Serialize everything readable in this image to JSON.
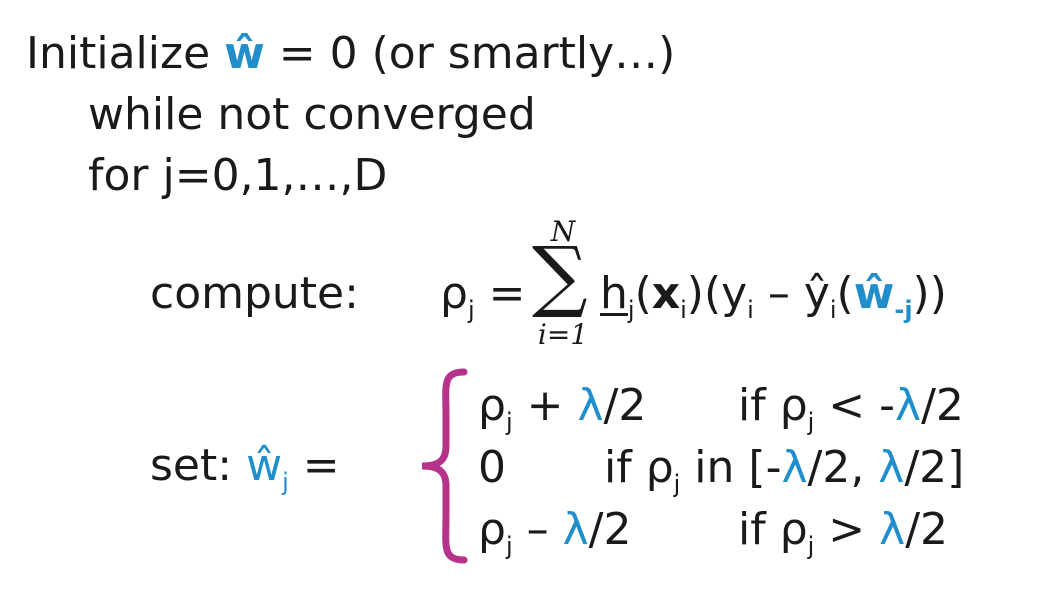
{
  "line1": {
    "pre": "Initialize ",
    "w": "ŵ",
    "post": " = 0 (or smartly…)"
  },
  "line2": {
    "text": "while not converged"
  },
  "line3": {
    "text": "for j=0,1,…,D"
  },
  "compute": {
    "label": "compute:",
    "rho": "ρ",
    "j": "j",
    "eq": " =",
    "sum_top": "N",
    "sum_bottom": "i=1",
    "h": "h",
    "hsub": "j",
    "paren_open": "(",
    "x": "x",
    "xsub": "i",
    "mid": ")(y",
    "ysub": "i",
    "minus": " – ŷ",
    "yhatsub": "i",
    "open2": "(",
    "w": "ŵ",
    "wsub": "-j",
    "close": "))"
  },
  "set": {
    "label": "set:  ",
    "w": "ŵ",
    "wsub": "j",
    "eq": " ="
  },
  "cases": [
    {
      "a1": "ρ",
      "a1sub": "j",
      "a2": " + ",
      "lam": "λ",
      "a3": "/2",
      "cond1": "if ρ",
      "condsub": "j",
      "cond2": " < -",
      "clam": "λ",
      "cond3": "/2"
    },
    {
      "a1": "0",
      "cond1": "if ρ",
      "condsub": "j",
      "cond2": " in [-",
      "clam": "λ",
      "cond3": "/2, ",
      "clam2": "λ",
      "cond4": "/2]"
    },
    {
      "a1": "ρ",
      "a1sub": "j",
      "a2": " – ",
      "lam": "λ",
      "a3": "/2",
      "cond1": "if ρ",
      "condsub": "j",
      "cond2": " > ",
      "clam": "λ",
      "cond3": "/2"
    }
  ],
  "colors": {
    "accent": "#1f8ecb",
    "brace": "#b5338a",
    "text": "#1a1a1a"
  }
}
